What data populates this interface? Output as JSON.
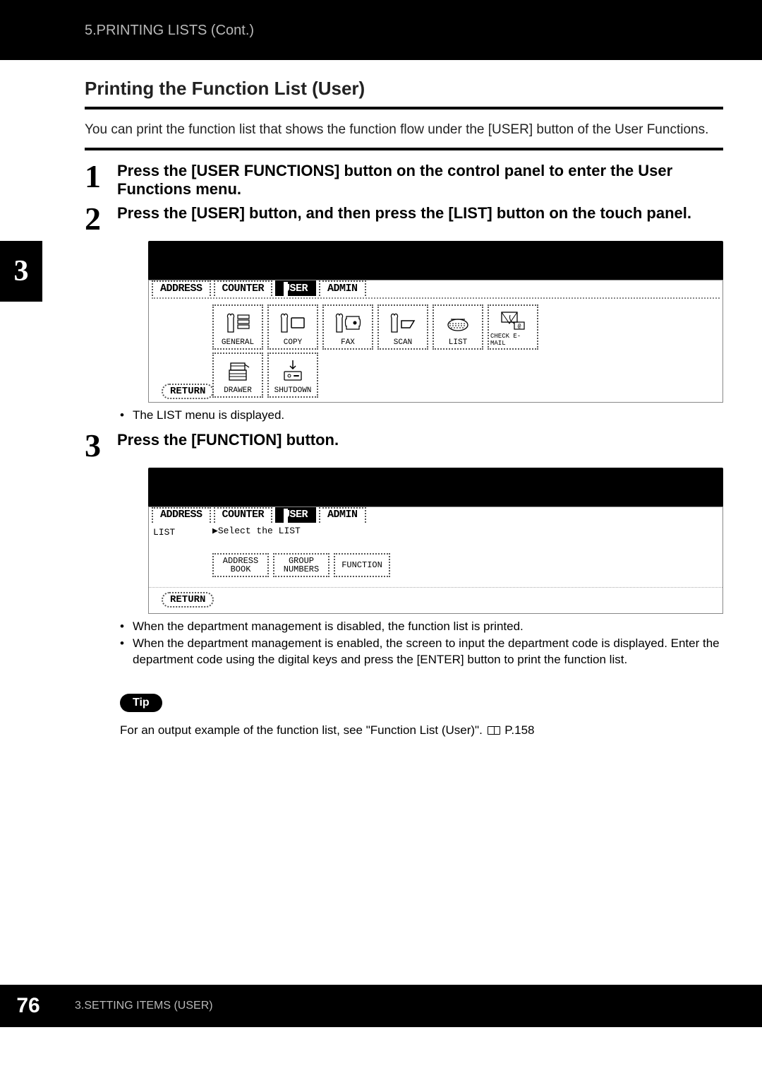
{
  "header": {
    "breadcrumb": "5.PRINTING LISTS (Cont.)"
  },
  "chapter": {
    "tab_number": "3"
  },
  "section": {
    "heading": "Printing the Function List (User)",
    "intro": "You can print the function list that shows the function flow under the [USER] button of the User Functions."
  },
  "steps": [
    {
      "num": "1",
      "text": "Press the [USER FUNCTIONS] button on the control panel to enter the User Functions menu."
    },
    {
      "num": "2",
      "text": "Press the [USER] button, and then press the [LIST] button on the touch panel."
    },
    {
      "num": "3",
      "text": "Press the [FUNCTION] button."
    }
  ],
  "panel1": {
    "tabs": [
      "ADDRESS",
      "COUNTER",
      "USER",
      "ADMIN"
    ],
    "selected_tab": "USER",
    "buttons_row1": [
      "GENERAL",
      "COPY",
      "FAX",
      "SCAN",
      "LIST",
      "CHECK E-MAIL"
    ],
    "buttons_row2": [
      "DRAWER",
      "SHUTDOWN"
    ],
    "return": "RETURN"
  },
  "after_panel1_bullets": [
    "The LIST menu is displayed."
  ],
  "panel2": {
    "tabs": [
      "ADDRESS",
      "COUNTER",
      "USER",
      "ADMIN"
    ],
    "selected_tab": "USER",
    "left_label": "LIST",
    "prompt": "▶Select the LIST",
    "buttons": [
      {
        "line1": "ADDRESS",
        "line2": "BOOK"
      },
      {
        "line1": "GROUP",
        "line2": "NUMBERS"
      },
      {
        "line1": "FUNCTION",
        "line2": ""
      }
    ],
    "return": "RETURN"
  },
  "after_panel2_bullets": [
    "When the department management is disabled, the function list is printed.",
    "When the department management is enabled, the screen to input the department code is displayed.  Enter the department code using the digital keys and press the [ENTER] button to print the function list."
  ],
  "tip": {
    "badge": "Tip",
    "text_prefix": "For an output example of the function list, see \"Function List (User)\".  ",
    "page_ref": "P.158"
  },
  "footer": {
    "page": "76",
    "text": "3.SETTING ITEMS (USER)"
  }
}
